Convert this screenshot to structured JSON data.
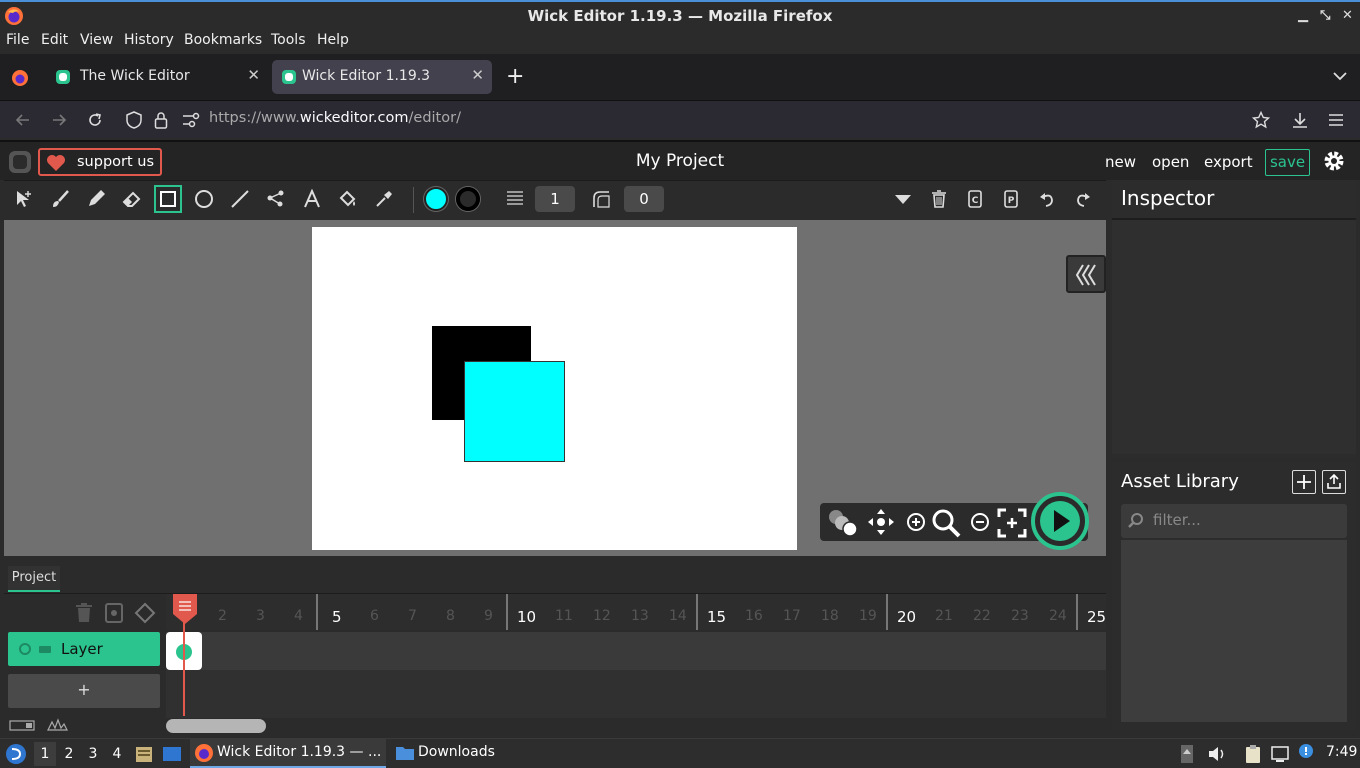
{
  "window": {
    "title": "Wick Editor 1.19.3 — Mozilla Firefox"
  },
  "menu": [
    "File",
    "Edit",
    "View",
    "History",
    "Bookmarks",
    "Tools",
    "Help"
  ],
  "tabs": [
    {
      "label": "The Wick Editor",
      "active": false
    },
    {
      "label": "Wick Editor 1.19.3",
      "active": true
    }
  ],
  "url": {
    "prefix": "https://www.",
    "domain": "wickeditor.com",
    "path": "/editor/"
  },
  "header": {
    "support_label": "support us",
    "project_name": "My Project",
    "new_label": "new",
    "open_label": "open",
    "export_label": "export",
    "save_label": "save"
  },
  "toolbar": {
    "fill_color": "#00ffff",
    "stroke_color": "#000000",
    "stroke_width": "1",
    "corner_radius": "0"
  },
  "inspector": {
    "title": "Inspector"
  },
  "assets": {
    "title": "Asset Library",
    "filter_placeholder": "filter..."
  },
  "timeline": {
    "tab_label": "Project",
    "layer_name": "Layer",
    "add_layer_label": "+",
    "frames": [
      "2",
      "3",
      "4",
      "5",
      "6",
      "7",
      "8",
      "9",
      "10",
      "11",
      "12",
      "13",
      "14",
      "15",
      "16",
      "17",
      "18",
      "19",
      "20",
      "21",
      "22",
      "23",
      "24",
      "25"
    ],
    "major_frames": [
      "5",
      "10",
      "15",
      "20",
      "25"
    ]
  },
  "taskbar": {
    "workspaces": [
      "1",
      "2",
      "3",
      "4"
    ],
    "firefox_task": "Wick Editor 1.19.3 — ...",
    "downloads_task": "Downloads",
    "clock": "7:49"
  },
  "colors": {
    "accent": "#2bc48e",
    "playhead": "#e1584c",
    "shape_black": "#000000",
    "shape_cyan": "#00ffff"
  }
}
